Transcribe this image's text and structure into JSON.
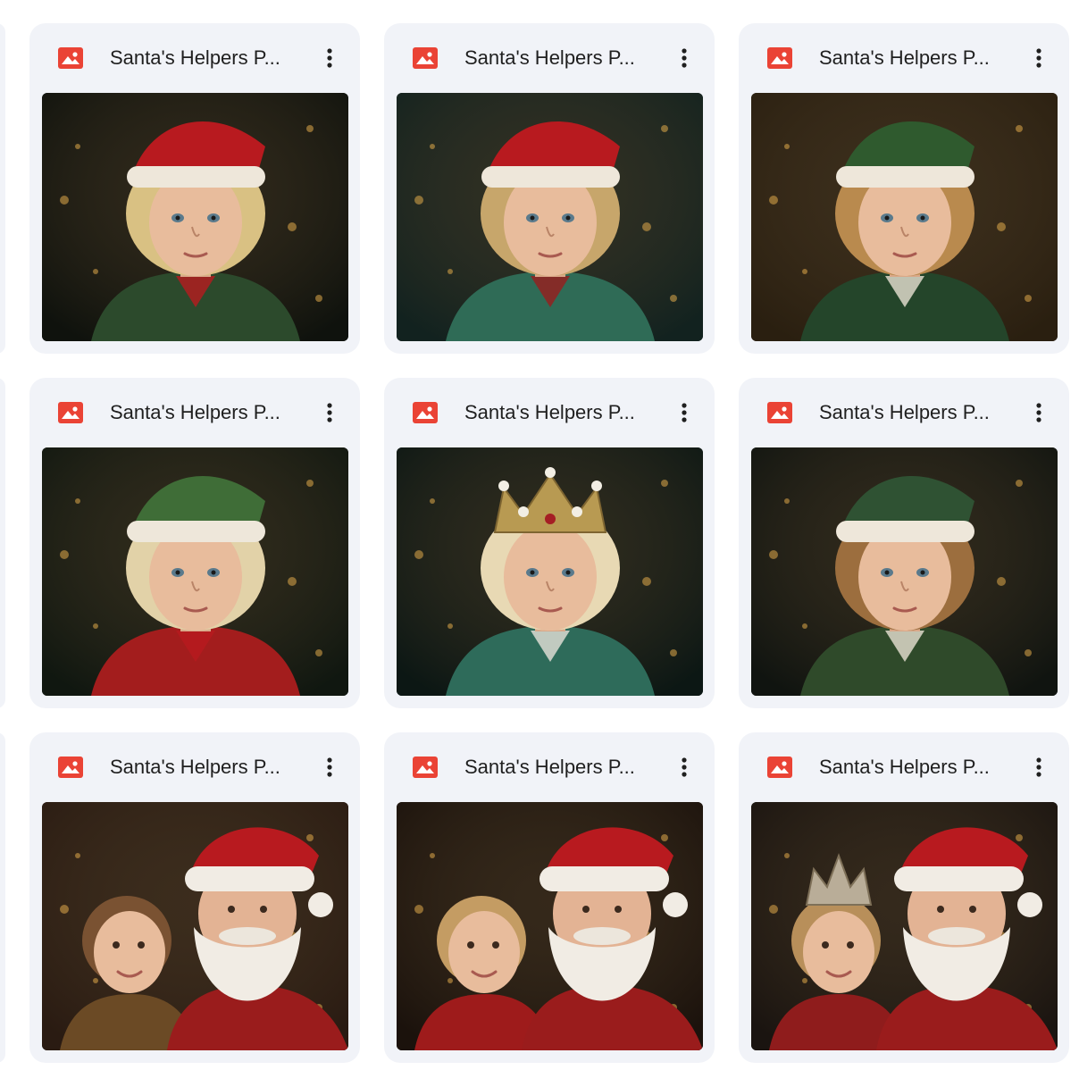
{
  "files": [
    {
      "name": "Santa's Helpers P...",
      "icon": "image-file-icon",
      "scene": {
        "bg": "#0f120d",
        "hat": "#b81a1f",
        "hair": "#d9c183",
        "outfit": "#2c4a2c",
        "accent": "#b81a1f",
        "santa": false,
        "crown": false
      }
    },
    {
      "name": "Santa's Helpers P...",
      "icon": "image-file-icon",
      "scene": {
        "bg": "#12221f",
        "hat": "#b81a1f",
        "hair": "#c7a66b",
        "outfit": "#2f6b56",
        "accent": "#9a1d1d",
        "santa": false,
        "crown": false
      }
    },
    {
      "name": "Santa's Helpers P...",
      "icon": "image-file-icon",
      "scene": {
        "bg": "#2a1f10",
        "hat": "#2f5a2e",
        "hair": "#b98a4e",
        "outfit": "#24452a",
        "accent": "#e8e1d3",
        "santa": false,
        "crown": false
      }
    },
    {
      "name": "Santa's Helpers P...",
      "icon": "image-file-icon",
      "scene": {
        "bg": "#101710",
        "hat": "#3f6d37",
        "hair": "#e2d2a8",
        "outfit": "#a31d1d",
        "accent": "#b81a1f",
        "santa": false,
        "crown": false
      }
    },
    {
      "name": "Santa's Helpers P...",
      "icon": "image-file-icon",
      "scene": {
        "bg": "#0c1714",
        "hat": "#b49a5a",
        "hair": "#e8d9b4",
        "outfit": "#2e6b5a",
        "accent": "#e6e2da",
        "santa": false,
        "crown": true
      }
    },
    {
      "name": "Santa's Helpers P...",
      "icon": "image-file-icon",
      "scene": {
        "bg": "#101410",
        "hat": "#2f5233",
        "hair": "#9c6e3e",
        "outfit": "#2f4a2a",
        "accent": "#e8e1d3",
        "santa": false,
        "crown": false
      }
    },
    {
      "name": "Santa's Helpers P...",
      "icon": "image-file-icon",
      "scene": {
        "bg": "#2a1b12",
        "hat": "#b81a1f",
        "hair": "#7a5232",
        "outfit": "#6b4a25",
        "accent": "#efe6d6",
        "santa": true,
        "crown": false
      }
    },
    {
      "name": "Santa's Helpers P...",
      "icon": "image-file-icon",
      "scene": {
        "bg": "#1b120c",
        "hat": "#b81a1f",
        "hair": "#c49c63",
        "outfit": "#9e1b1b",
        "accent": "#efe6d6",
        "santa": true,
        "crown": false
      }
    },
    {
      "name": "Santa's Helpers P...",
      "icon": "image-file-icon",
      "scene": {
        "bg": "#1a1410",
        "hat": "#b81a1f",
        "hair": "#b88f5a",
        "outfit": "#8f1c1c",
        "accent": "#2f6b3a",
        "santa": true,
        "crown": true
      }
    }
  ]
}
